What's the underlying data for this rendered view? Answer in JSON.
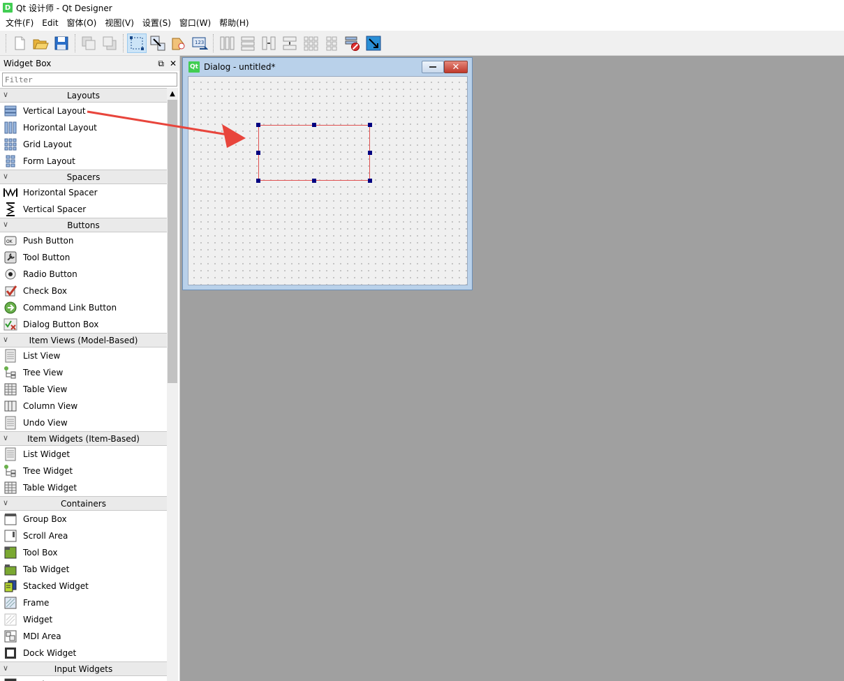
{
  "window": {
    "title": "Qt 设计师 - Qt Designer",
    "icon": "D"
  },
  "menu": [
    {
      "label": "文件(F)"
    },
    {
      "label": "Edit"
    },
    {
      "label": "窗体(O)"
    },
    {
      "label": "视图(V)"
    },
    {
      "label": "设置(S)"
    },
    {
      "label": "窗口(W)"
    },
    {
      "label": "帮助(H)"
    }
  ],
  "toolbar": {
    "icons": [
      "new-file-icon",
      "open-folder-icon",
      "save-icon",
      "bring-to-front-icon",
      "send-to-back-icon",
      "edit-widgets-icon",
      "edit-signals-slots-icon",
      "edit-buddies-icon",
      "edit-tab-order-icon",
      "layout-horizontal-icon",
      "layout-vertical-icon",
      "layout-horizontal-splitter-icon",
      "layout-vertical-splitter-icon",
      "layout-grid-icon",
      "layout-form-icon",
      "break-layout-icon",
      "adjust-size-icon"
    ]
  },
  "widget_box": {
    "title": "Widget Box",
    "filter_placeholder": "Filter",
    "categories": [
      {
        "label": "Layouts",
        "items": [
          {
            "label": "Vertical Layout",
            "icon": "vertical-layout-icon"
          },
          {
            "label": "Horizontal Layout",
            "icon": "horizontal-layout-icon"
          },
          {
            "label": "Grid Layout",
            "icon": "grid-layout-icon"
          },
          {
            "label": "Form Layout",
            "icon": "form-layout-icon"
          }
        ]
      },
      {
        "label": "Spacers",
        "items": [
          {
            "label": "Horizontal Spacer",
            "icon": "horizontal-spacer-icon"
          },
          {
            "label": "Vertical Spacer",
            "icon": "vertical-spacer-icon"
          }
        ]
      },
      {
        "label": "Buttons",
        "items": [
          {
            "label": "Push Button",
            "icon": "push-button-icon"
          },
          {
            "label": "Tool Button",
            "icon": "tool-button-icon"
          },
          {
            "label": "Radio Button",
            "icon": "radio-button-icon"
          },
          {
            "label": "Check Box",
            "icon": "check-box-icon"
          },
          {
            "label": "Command Link Button",
            "icon": "command-link-icon"
          },
          {
            "label": "Dialog Button Box",
            "icon": "dialog-button-box-icon"
          }
        ]
      },
      {
        "label": "Item Views (Model-Based)",
        "items": [
          {
            "label": "List View",
            "icon": "list-view-icon"
          },
          {
            "label": "Tree View",
            "icon": "tree-view-icon"
          },
          {
            "label": "Table View",
            "icon": "table-view-icon"
          },
          {
            "label": "Column View",
            "icon": "column-view-icon"
          },
          {
            "label": "Undo View",
            "icon": "undo-view-icon"
          }
        ]
      },
      {
        "label": "Item Widgets (Item-Based)",
        "items": [
          {
            "label": "List Widget",
            "icon": "list-widget-icon"
          },
          {
            "label": "Tree Widget",
            "icon": "tree-widget-icon"
          },
          {
            "label": "Table Widget",
            "icon": "table-widget-icon"
          }
        ]
      },
      {
        "label": "Containers",
        "items": [
          {
            "label": "Group Box",
            "icon": "group-box-icon"
          },
          {
            "label": "Scroll Area",
            "icon": "scroll-area-icon"
          },
          {
            "label": "Tool Box",
            "icon": "tool-box-icon"
          },
          {
            "label": "Tab Widget",
            "icon": "tab-widget-icon"
          },
          {
            "label": "Stacked Widget",
            "icon": "stacked-widget-icon"
          },
          {
            "label": "Frame",
            "icon": "frame-icon"
          },
          {
            "label": "Widget",
            "icon": "widget-icon"
          },
          {
            "label": "MDI Area",
            "icon": "mdi-area-icon"
          },
          {
            "label": "Dock Widget",
            "icon": "dock-widget-icon"
          }
        ]
      },
      {
        "label": "Input Widgets",
        "items": [
          {
            "label": "Combo Box",
            "icon": "combo-box-icon"
          }
        ]
      }
    ]
  },
  "dialog": {
    "title": "Dialog - untitled*",
    "icon": "Qt"
  },
  "colors": {
    "annotation_arrow": "#e8453c",
    "selection": "#e05050",
    "handle": "#000080"
  }
}
